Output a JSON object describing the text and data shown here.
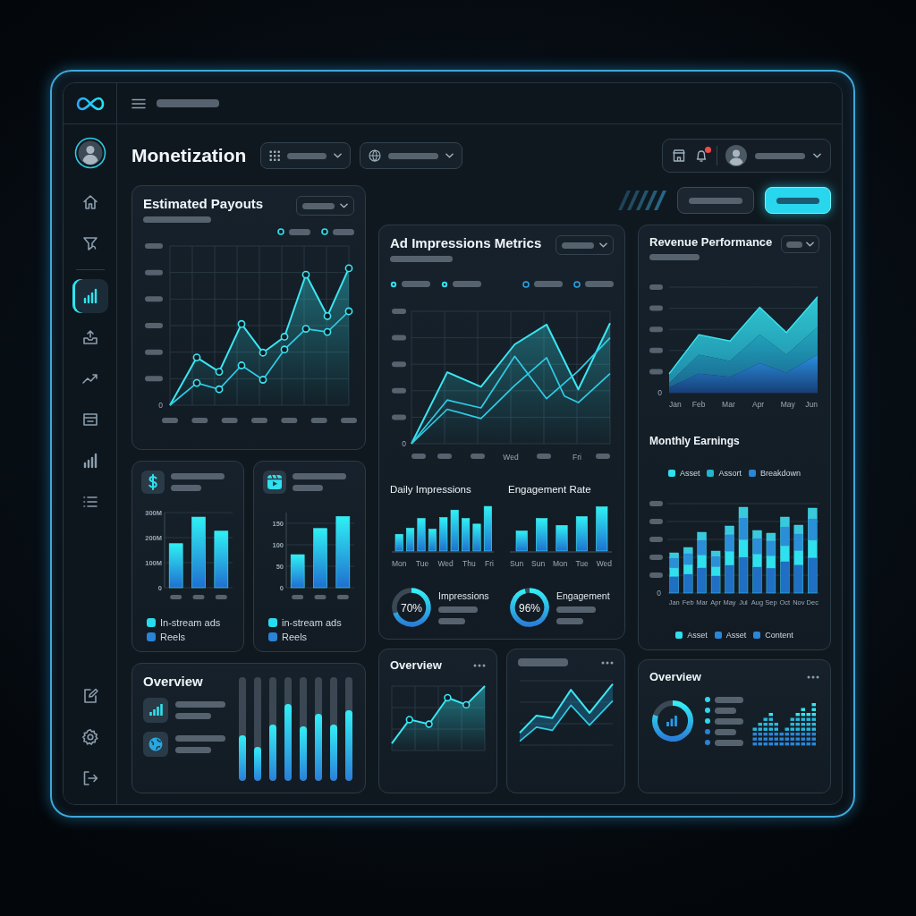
{
  "topbar": {
    "notifications": {
      "unread": true
    }
  },
  "sidebar": {
    "items": [
      {
        "selected": false
      },
      {
        "selected": false
      },
      {
        "selected": true
      },
      {
        "selected": false
      },
      {
        "selected": false
      },
      {
        "selected": false
      },
      {
        "selected": false
      },
      {
        "selected": false
      }
    ]
  },
  "header": {
    "title": "Monetization"
  },
  "estimated_payouts": {
    "title": "Estimated Payouts",
    "y_axis_label": "0"
  },
  "stat_cards": [
    {
      "legend": [
        {
          "label": "In-stream ads",
          "color": "#27dcef"
        },
        {
          "label": "Reels",
          "color": "#2a83d6"
        }
      ],
      "chart_data": {
        "type": "bar",
        "values": [
          176,
          282,
          226
        ],
        "ylim": [
          0,
          300
        ],
        "yticks": [
          {
            "value": 0,
            "label": "0"
          },
          {
            "value": 100,
            "label": "100M"
          },
          {
            "value": 200,
            "label": "200M"
          },
          {
            "value": 300,
            "label": "300M"
          }
        ],
        "grid": true
      }
    },
    {
      "legend": [
        {
          "label": "in-stream ads",
          "color": "#27dcef"
        },
        {
          "label": "Reels",
          "color": "#2a83d6"
        }
      ],
      "chart_data": {
        "type": "bar",
        "values": [
          77,
          138,
          166
        ],
        "ylim": [
          0,
          175
        ],
        "yticks": [
          0,
          50,
          100,
          150
        ],
        "grid": true
      }
    }
  ],
  "overview_meters": {
    "title": "Overview",
    "meters": [
      {
        "level": 0.44
      },
      {
        "level": 0.33
      },
      {
        "level": 0.54
      },
      {
        "level": 0.74
      },
      {
        "level": 0.53
      },
      {
        "level": 0.65
      },
      {
        "level": 0.54
      },
      {
        "level": 0.68
      }
    ]
  },
  "ad_impressions": {
    "title": "Ad Impressions Metrics",
    "y_axis_label": "0",
    "x_labels": [
      "Wed",
      "Fri"
    ],
    "daily": {
      "title": "Daily Impressions",
      "x_labels": [
        "Mon",
        "Tue",
        "Wed",
        "Thu",
        "Fri"
      ]
    },
    "engagement": {
      "title": "Engagement Rate",
      "x_labels": [
        "Sun",
        "Sun",
        "Mon",
        "Tue",
        "Wed"
      ]
    },
    "gauges": [
      {
        "value": "70%",
        "label": "Impressions"
      },
      {
        "value": "96%",
        "label": "Engagement"
      }
    ]
  },
  "revenue_performance": {
    "title": "Revenue Performance",
    "y_axis_label": "0",
    "x_labels": [
      "Jan",
      "Feb",
      "Mar",
      "Apr",
      "May",
      "Jun"
    ]
  },
  "monthly_earnings": {
    "title": "Monthly Earnings",
    "legend": [
      {
        "label": "Asset",
        "color": "#2fe0ee"
      },
      {
        "label": "Assort",
        "color": "#22b6cc"
      },
      {
        "label": "Breakdown",
        "color": "#2a86d6"
      }
    ],
    "y_axis_label": "0",
    "x_labels": [
      "Jan",
      "Feb",
      "Mar",
      "Apr",
      "May",
      "Jul",
      "Aug",
      "Sep",
      "Oct",
      "Nov",
      "Dec"
    ],
    "bottom_legend": [
      {
        "label": "Asset",
        "color": "#2fe0ee"
      },
      {
        "label": "Asset",
        "color": "#2a86d6"
      },
      {
        "label": "Content",
        "color": "#2a86d6"
      }
    ]
  },
  "overview_trend": {
    "title": "Overview"
  },
  "overview_summary": {
    "title": "Overview",
    "list_items": [
      {
        "color": "#2fd8ea"
      },
      {
        "color": "#2fd8ea"
      },
      {
        "color": "#2fd8ea"
      },
      {
        "color": "#2a83d6"
      },
      {
        "color": "#2a83d6"
      }
    ]
  }
}
